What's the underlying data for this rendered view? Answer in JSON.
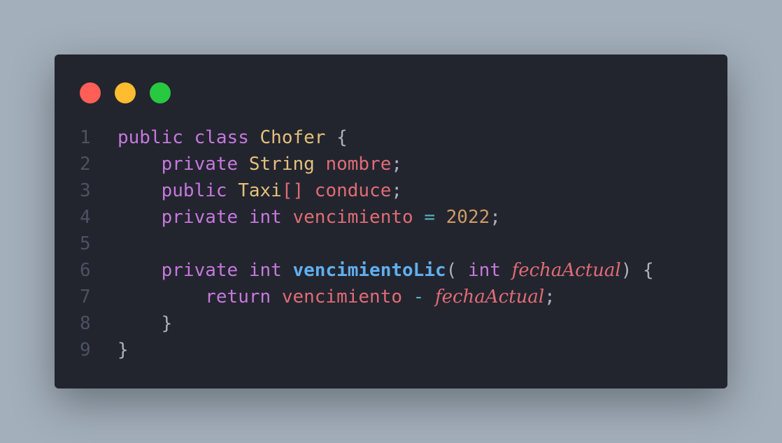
{
  "window": {
    "controls": [
      "close",
      "minimize",
      "maximize"
    ]
  },
  "code": {
    "lines": [
      {
        "num": "1",
        "tokens": [
          {
            "t": "public",
            "c": "kw"
          },
          {
            "t": " ",
            "c": "punc"
          },
          {
            "t": "class",
            "c": "kw"
          },
          {
            "t": " ",
            "c": "punc"
          },
          {
            "t": "Chofer",
            "c": "ty"
          },
          {
            "t": " {",
            "c": "punc"
          }
        ]
      },
      {
        "num": "2",
        "tokens": [
          {
            "t": "    ",
            "c": "punc"
          },
          {
            "t": "private",
            "c": "kw"
          },
          {
            "t": " ",
            "c": "punc"
          },
          {
            "t": "String",
            "c": "ty"
          },
          {
            "t": " ",
            "c": "punc"
          },
          {
            "t": "nombre",
            "c": "var"
          },
          {
            "t": ";",
            "c": "punc"
          }
        ]
      },
      {
        "num": "3",
        "tokens": [
          {
            "t": "    ",
            "c": "punc"
          },
          {
            "t": "public",
            "c": "kw"
          },
          {
            "t": " ",
            "c": "punc"
          },
          {
            "t": "Taxi",
            "c": "ty"
          },
          {
            "t": "[]",
            "c": "var"
          },
          {
            "t": " ",
            "c": "punc"
          },
          {
            "t": "conduce",
            "c": "var"
          },
          {
            "t": ";",
            "c": "punc"
          }
        ]
      },
      {
        "num": "4",
        "tokens": [
          {
            "t": "    ",
            "c": "punc"
          },
          {
            "t": "private",
            "c": "kw"
          },
          {
            "t": " ",
            "c": "punc"
          },
          {
            "t": "int",
            "c": "kw"
          },
          {
            "t": " ",
            "c": "punc"
          },
          {
            "t": "vencimiento",
            "c": "var"
          },
          {
            "t": " ",
            "c": "punc"
          },
          {
            "t": "=",
            "c": "op"
          },
          {
            "t": " ",
            "c": "punc"
          },
          {
            "t": "2022",
            "c": "num"
          },
          {
            "t": ";",
            "c": "punc"
          }
        ]
      },
      {
        "num": "5",
        "tokens": []
      },
      {
        "num": "6",
        "tokens": [
          {
            "t": "    ",
            "c": "punc"
          },
          {
            "t": "private",
            "c": "kw"
          },
          {
            "t": " ",
            "c": "punc"
          },
          {
            "t": "int",
            "c": "kw"
          },
          {
            "t": " ",
            "c": "punc"
          },
          {
            "t": "vencimientoLic",
            "c": "fn"
          },
          {
            "t": "( ",
            "c": "punc"
          },
          {
            "t": "int",
            "c": "kw"
          },
          {
            "t": " ",
            "c": "punc"
          },
          {
            "t": "fechaActual",
            "c": "param"
          },
          {
            "t": ") {",
            "c": "punc"
          }
        ]
      },
      {
        "num": "7",
        "tokens": [
          {
            "t": "        ",
            "c": "punc"
          },
          {
            "t": "return",
            "c": "kw"
          },
          {
            "t": " ",
            "c": "punc"
          },
          {
            "t": "vencimiento",
            "c": "var"
          },
          {
            "t": " ",
            "c": "punc"
          },
          {
            "t": "-",
            "c": "op"
          },
          {
            "t": " ",
            "c": "punc"
          },
          {
            "t": "fechaActual",
            "c": "param"
          },
          {
            "t": ";",
            "c": "punc"
          }
        ]
      },
      {
        "num": "8",
        "tokens": [
          {
            "t": "    ",
            "c": "punc"
          },
          {
            "t": "}",
            "c": "punc"
          }
        ]
      },
      {
        "num": "9",
        "tokens": [
          {
            "t": "}",
            "c": "punc"
          }
        ]
      }
    ]
  }
}
